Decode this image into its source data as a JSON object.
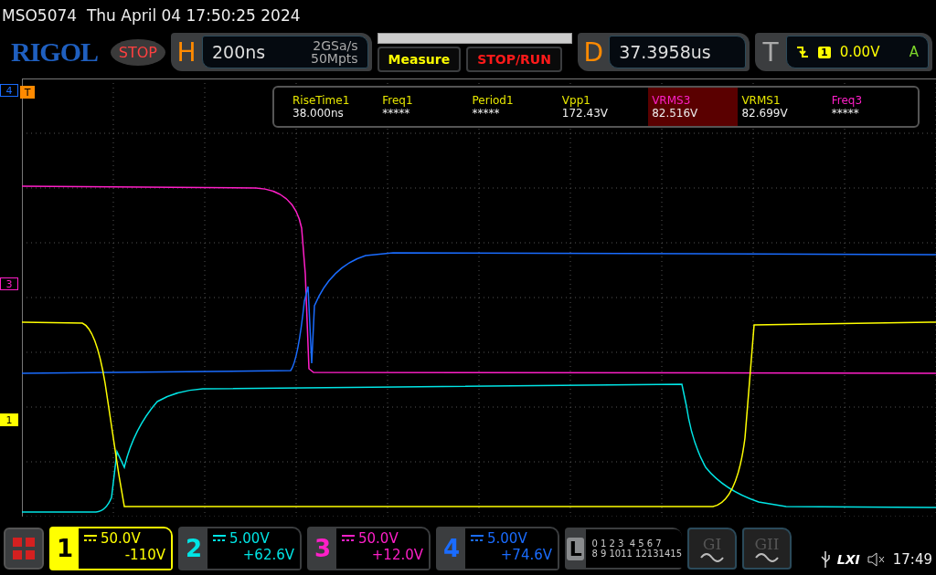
{
  "header": {
    "model": "MSO5074",
    "datetime": "Thu April 04 17:50:25 2024"
  },
  "toolbar": {
    "logo": "RIGOL",
    "run_state": "STOP",
    "horizontal": {
      "letter": "H",
      "timebase": "200ns",
      "sample_rate": "2GSa/s",
      "memory": "50Mpts"
    },
    "measure_button": "Measure",
    "stop_run_button": "STOP/RUN",
    "delay": {
      "letter": "D",
      "value": "37.3958us"
    },
    "trigger": {
      "letter": "T",
      "source": "1",
      "level": "0.00V",
      "mode": "A"
    }
  },
  "markers": [
    {
      "label": "4",
      "color": "#1a6cff",
      "kind": "channel"
    },
    {
      "label": "T",
      "color": "#ff8a00",
      "kind": "trigger"
    },
    {
      "label": "3",
      "color": "#ff1fc8",
      "kind": "channel"
    },
    {
      "label": "1",
      "color": "#ffff00",
      "kind": "channel"
    }
  ],
  "measurements": [
    {
      "label": "RiseTime1",
      "value": "38.000ns",
      "color": "#e6e600",
      "selected": false
    },
    {
      "label": "Freq1",
      "value": "*****",
      "color": "#e6e600",
      "selected": false
    },
    {
      "label": "Period1",
      "value": "*****",
      "color": "#e6e600",
      "selected": false
    },
    {
      "label": "Vpp1",
      "value": "172.43V",
      "color": "#e6e600",
      "selected": false
    },
    {
      "label": "VRMS3",
      "value": "82.516V",
      "color": "#ff1fc8",
      "selected": true
    },
    {
      "label": "VRMS1",
      "value": "82.699V",
      "color": "#e6e600",
      "selected": false
    },
    {
      "label": "Freq3",
      "value": "*****",
      "color": "#ff1fc8",
      "selected": false
    }
  ],
  "channels": [
    {
      "number": "1",
      "scale": "50.0V",
      "offset": "-110V",
      "color": "#ffff00",
      "selected": true
    },
    {
      "number": "2",
      "scale": "5.00V",
      "offset": "+62.6V",
      "color": "#00e5e5",
      "selected": false
    },
    {
      "number": "3",
      "scale": "50.0V",
      "offset": "+12.0V",
      "color": "#ff1fc8",
      "selected": false
    },
    {
      "number": "4",
      "scale": "5.00V",
      "offset": "+74.6V",
      "color": "#1a6cff",
      "selected": false
    }
  ],
  "logic": {
    "letter": "L",
    "bits_row_1": "0 1 2 3  4 5 6 7",
    "bits_row_2": "8 9 1011 12131415"
  },
  "generators": [
    "GI",
    "GII"
  ],
  "status": {
    "lxi": "LXI",
    "time": "17:49"
  }
}
